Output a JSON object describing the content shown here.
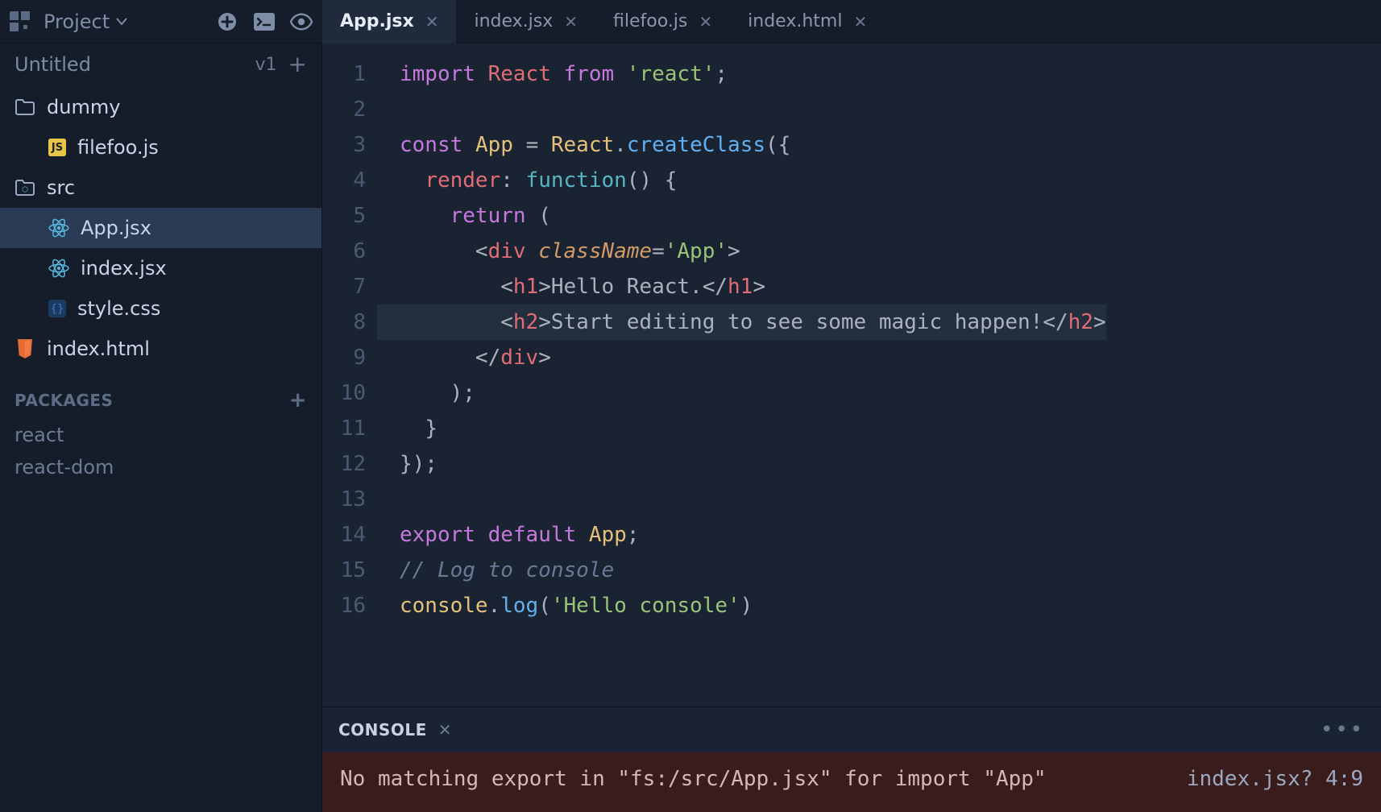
{
  "topbar": {
    "project_label": "Project",
    "actions": {
      "add": "add",
      "terminal": "terminal",
      "preview": "preview"
    }
  },
  "sidebar": {
    "title": "Untitled",
    "version": "v1",
    "tree": [
      {
        "name": "dummy",
        "icon": "folder",
        "depth": 0
      },
      {
        "name": "filefoo.js",
        "icon": "js",
        "depth": 1
      },
      {
        "name": "src",
        "icon": "folder-src",
        "depth": 0
      },
      {
        "name": "App.jsx",
        "icon": "react",
        "depth": 1,
        "selected": true
      },
      {
        "name": "index.jsx",
        "icon": "react",
        "depth": 1
      },
      {
        "name": "style.css",
        "icon": "css",
        "depth": 1
      },
      {
        "name": "index.html",
        "icon": "html",
        "depth": 0
      }
    ],
    "packages_label": "PACKAGES",
    "packages": [
      "react",
      "react-dom"
    ]
  },
  "tabs": [
    {
      "label": "App.jsx",
      "active": true
    },
    {
      "label": "index.jsx",
      "active": false
    },
    {
      "label": "filefoo.js",
      "active": false
    },
    {
      "label": "index.html",
      "active": false
    }
  ],
  "editor": {
    "highlight_line": 8,
    "lines": [
      [
        [
          "kw",
          "import"
        ],
        [
          "sp",
          " "
        ],
        [
          "id",
          "React"
        ],
        [
          "sp",
          " "
        ],
        [
          "kw",
          "from"
        ],
        [
          "sp",
          " "
        ],
        [
          "str",
          "'react'"
        ],
        [
          "pn",
          ";"
        ]
      ],
      [],
      [
        [
          "kw",
          "const"
        ],
        [
          "sp",
          " "
        ],
        [
          "id2",
          "App"
        ],
        [
          "sp",
          " "
        ],
        [
          "pn",
          "="
        ],
        [
          "sp",
          " "
        ],
        [
          "id2",
          "React"
        ],
        [
          "pn",
          "."
        ],
        [
          "func",
          "createClass"
        ],
        [
          "pn",
          "({"
        ]
      ],
      [
        [
          "sp",
          "  "
        ],
        [
          "prop",
          "render"
        ],
        [
          "pn",
          ":"
        ],
        [
          "sp",
          " "
        ],
        [
          "fn",
          "function"
        ],
        [
          "pn",
          "()"
        ],
        [
          "sp",
          " "
        ],
        [
          "pn",
          "{"
        ]
      ],
      [
        [
          "sp",
          "    "
        ],
        [
          "kw",
          "return"
        ],
        [
          "sp",
          " "
        ],
        [
          "pn",
          "("
        ]
      ],
      [
        [
          "sp",
          "      "
        ],
        [
          "pn",
          "<"
        ],
        [
          "tag",
          "div"
        ],
        [
          "sp",
          " "
        ],
        [
          "attr",
          "className"
        ],
        [
          "pn",
          "="
        ],
        [
          "str",
          "'App'"
        ],
        [
          "pn",
          ">"
        ]
      ],
      [
        [
          "sp",
          "        "
        ],
        [
          "pn",
          "<"
        ],
        [
          "tag",
          "h1"
        ],
        [
          "pn",
          ">"
        ],
        [
          "txt",
          "Hello React."
        ],
        [
          "pn",
          "</"
        ],
        [
          "tag",
          "h1"
        ],
        [
          "pn",
          ">"
        ]
      ],
      [
        [
          "sp",
          "        "
        ],
        [
          "pn",
          "<"
        ],
        [
          "tag",
          "h2"
        ],
        [
          "pn",
          ">"
        ],
        [
          "txt",
          "Start editing to see some magic happen!"
        ],
        [
          "pn",
          "</"
        ],
        [
          "tag",
          "h2"
        ],
        [
          "pn",
          ">"
        ]
      ],
      [
        [
          "sp",
          "      "
        ],
        [
          "pn",
          "</"
        ],
        [
          "tag",
          "div"
        ],
        [
          "pn",
          ">"
        ]
      ],
      [
        [
          "sp",
          "    "
        ],
        [
          "pn",
          ");"
        ]
      ],
      [
        [
          "sp",
          "  "
        ],
        [
          "pn",
          "}"
        ]
      ],
      [
        [
          "pn",
          "});"
        ]
      ],
      [],
      [
        [
          "kw",
          "export"
        ],
        [
          "sp",
          " "
        ],
        [
          "kw",
          "default"
        ],
        [
          "sp",
          " "
        ],
        [
          "id2",
          "App"
        ],
        [
          "pn",
          ";"
        ]
      ],
      [
        [
          "cmt",
          "// Log to console"
        ]
      ],
      [
        [
          "id2",
          "console"
        ],
        [
          "pn",
          "."
        ],
        [
          "func",
          "log"
        ],
        [
          "pn",
          "("
        ],
        [
          "str",
          "'Hello console'"
        ],
        [
          "pn",
          ")"
        ]
      ]
    ]
  },
  "console": {
    "tab_label": "CONSOLE",
    "message": "No matching export in \"fs:/src/App.jsx\" for import \"App\"",
    "location": "index.jsx? 4:9"
  }
}
